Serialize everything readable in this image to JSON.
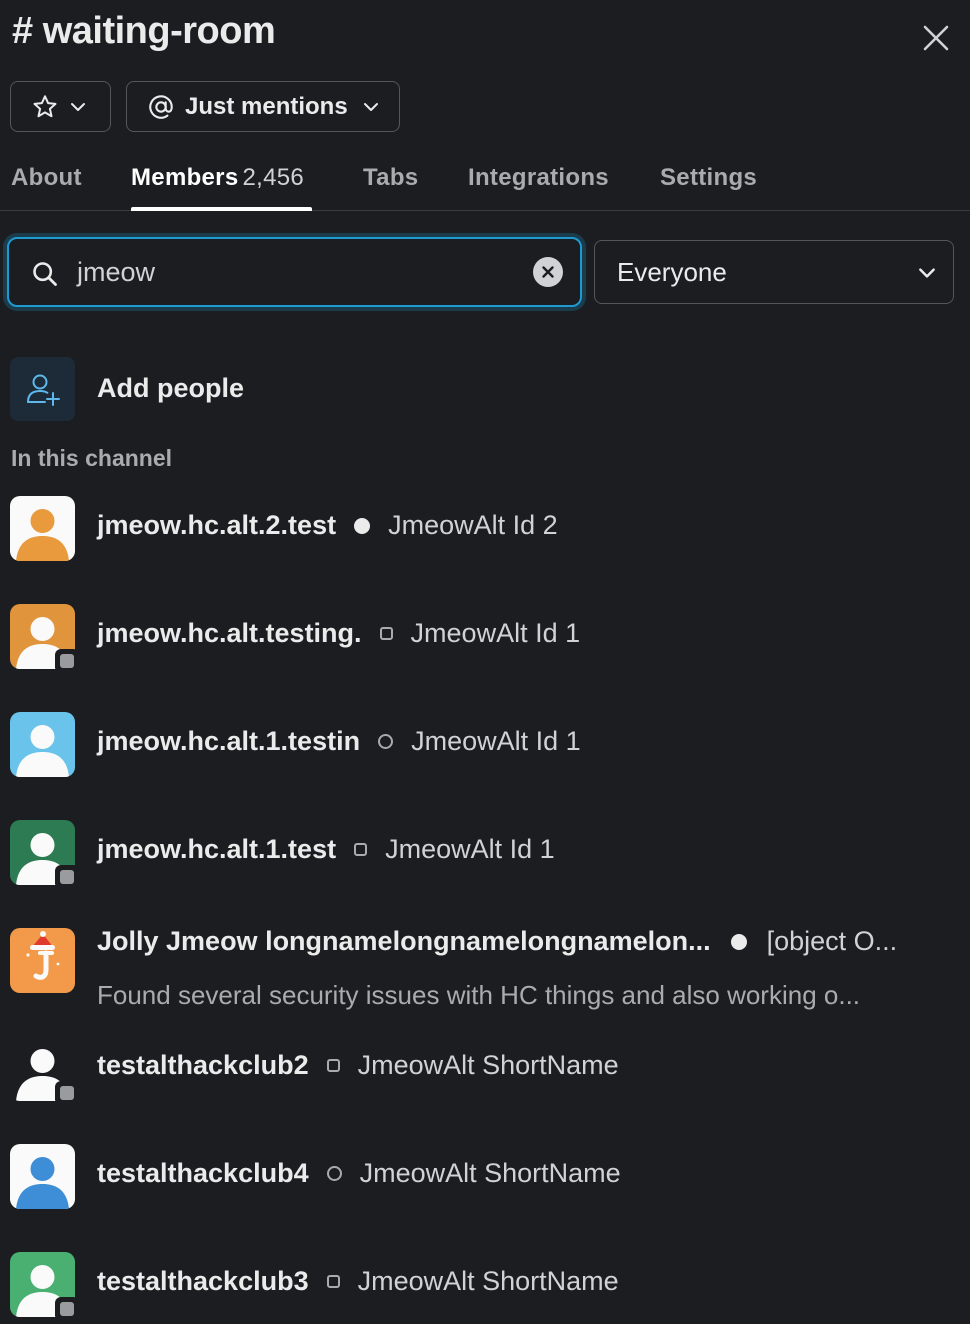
{
  "header": {
    "title": "# waiting-room"
  },
  "controls": {
    "mentions_label": "Just mentions"
  },
  "tabs": [
    {
      "label": "About"
    },
    {
      "label": "Members",
      "count": "2,456"
    },
    {
      "label": "Tabs"
    },
    {
      "label": "Integrations"
    },
    {
      "label": "Settings"
    }
  ],
  "search": {
    "value": "jmeow"
  },
  "filter": {
    "value": "Everyone"
  },
  "add_people": {
    "label": "Add people"
  },
  "section_label": "In this channel",
  "members": [
    {
      "username": "jmeow.hc.alt.2.test",
      "status": "active",
      "display_name": "JmeowAlt Id 2",
      "avatar_color": "#f2a03d"
    },
    {
      "username": "jmeow.hc.alt.testing.",
      "status": "away",
      "display_name": "JmeowAlt Id 1",
      "avatar_color": "#e0953c"
    },
    {
      "username": "jmeow.hc.alt.1.testin",
      "status": "away",
      "display_name": "JmeowAlt Id 1",
      "avatar_color": "#69c3ea"
    },
    {
      "username": "jmeow.hc.alt.1.test",
      "status": "away",
      "display_name": "JmeowAlt Id 1",
      "avatar_color": "#2d7b52"
    },
    {
      "username": "Jolly Jmeow longnamelongnamelongnamelon...",
      "status": "active",
      "display_name": "[object O...",
      "description": "Found several security issues with HC things and also working o...",
      "avatar_color": "#f39a4a"
    },
    {
      "username": "testalthackclub2",
      "status": "away",
      "display_name": "JmeowAlt ShortName",
      "avatar_color": "#1b1d21"
    },
    {
      "username": "testalthackclub4",
      "status": "away",
      "display_name": "JmeowAlt ShortName",
      "avatar_color": "#3d8ed6"
    },
    {
      "username": "testalthackclub3",
      "status": "away",
      "display_name": "JmeowAlt ShortName",
      "avatar_color": "#49b071"
    }
  ]
}
